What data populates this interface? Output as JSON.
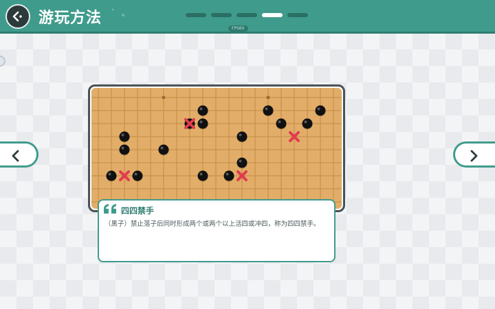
{
  "header": {
    "title": "游玩方法",
    "fps_label": "FPS60",
    "progress": {
      "total": 5,
      "current": 4
    }
  },
  "icons": {
    "back": "back-arrow-icon",
    "prev": "chevron-left-icon",
    "next": "chevron-right-icon",
    "quote": "quote-icon"
  },
  "colors": {
    "accent": "#3f9b8c",
    "board": "#e2ad68",
    "stone": "#111111",
    "forbidden_mark": "#e23b4e"
  },
  "board": {
    "grid_columns": 19,
    "grid_rows": 9,
    "black_stones": [
      [
        8,
        1
      ],
      [
        8,
        2
      ],
      [
        7,
        2
      ],
      [
        13,
        1
      ],
      [
        14,
        2
      ],
      [
        16,
        2
      ],
      [
        17,
        1
      ],
      [
        2,
        3
      ],
      [
        2,
        4
      ],
      [
        5,
        4
      ],
      [
        11,
        3
      ],
      [
        1,
        6
      ],
      [
        3,
        6
      ],
      [
        8,
        6
      ],
      [
        10,
        6
      ],
      [
        11,
        5
      ]
    ],
    "forbidden_points": [
      [
        7,
        2
      ],
      [
        15,
        3
      ],
      [
        2,
        6
      ],
      [
        11,
        6
      ]
    ],
    "star_points": [
      [
        5,
        0
      ],
      [
        13,
        0
      ]
    ]
  },
  "card": {
    "title": "四四禁手",
    "body": "（黑子）禁止落子后同时形成两个或两个以上活四或冲四，称为四四禁手。"
  }
}
